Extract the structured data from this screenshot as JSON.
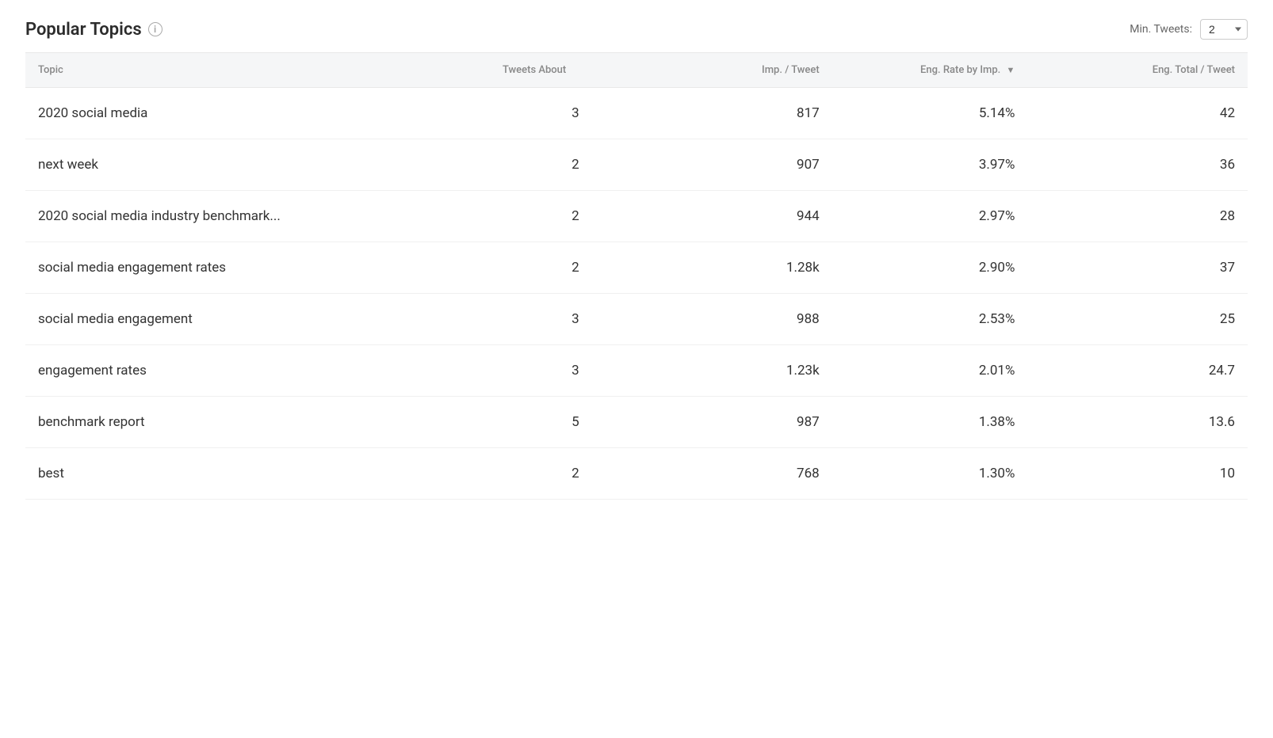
{
  "header": {
    "title": "Popular Topics",
    "info_icon_label": "i",
    "min_tweets_label": "Min. Tweets:",
    "min_tweets_value": "2"
  },
  "columns": [
    {
      "key": "topic",
      "label": "Topic",
      "sortable": false,
      "align": "left"
    },
    {
      "key": "tweets_about",
      "label": "Tweets About",
      "sortable": false,
      "align": "center"
    },
    {
      "key": "imp_tweet",
      "label": "Imp. / Tweet",
      "sortable": false,
      "align": "right"
    },
    {
      "key": "eng_rate",
      "label": "Eng. Rate by Imp.",
      "sortable": true,
      "align": "right"
    },
    {
      "key": "eng_total",
      "label": "Eng. Total / Tweet",
      "sortable": false,
      "align": "right"
    }
  ],
  "rows": [
    {
      "topic": "2020 social media",
      "tweets_about": "3",
      "imp_tweet": "817",
      "eng_rate": "5.14%",
      "eng_total": "42"
    },
    {
      "topic": "next week",
      "tweets_about": "2",
      "imp_tweet": "907",
      "eng_rate": "3.97%",
      "eng_total": "36"
    },
    {
      "topic": "2020 social media industry benchmark...",
      "tweets_about": "2",
      "imp_tweet": "944",
      "eng_rate": "2.97%",
      "eng_total": "28"
    },
    {
      "topic": "social media engagement rates",
      "tweets_about": "2",
      "imp_tweet": "1.28k",
      "eng_rate": "2.90%",
      "eng_total": "37"
    },
    {
      "topic": "social media engagement",
      "tweets_about": "3",
      "imp_tweet": "988",
      "eng_rate": "2.53%",
      "eng_total": "25"
    },
    {
      "topic": "engagement rates",
      "tweets_about": "3",
      "imp_tweet": "1.23k",
      "eng_rate": "2.01%",
      "eng_total": "24.7"
    },
    {
      "topic": "benchmark report",
      "tweets_about": "5",
      "imp_tweet": "987",
      "eng_rate": "1.38%",
      "eng_total": "13.6"
    },
    {
      "topic": "best",
      "tweets_about": "2",
      "imp_tweet": "768",
      "eng_rate": "1.30%",
      "eng_total": "10"
    }
  ]
}
